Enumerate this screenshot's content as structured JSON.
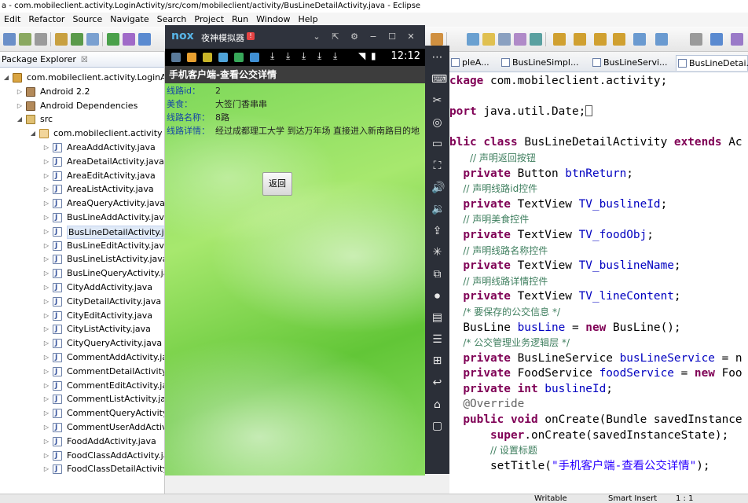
{
  "window": {
    "title": "a - com.mobileclient.activity.LoginActivity/src/com/mobileclient/activity/BusLineDetailActivity.java - Eclipse"
  },
  "menu": [
    "Edit",
    "Refactor",
    "Source",
    "Navigate",
    "Search",
    "Project",
    "Run",
    "Window",
    "Help"
  ],
  "package_explorer": {
    "tab_label": "Package Explorer",
    "tab_close": "☒",
    "nodes": [
      {
        "label": "com.mobileclient.activity.LoginActivity",
        "icon": "project-icon",
        "twisty": "◢"
      },
      {
        "label": "Android 2.2",
        "icon": "library-icon",
        "twisty": "▷"
      },
      {
        "label": "Android Dependencies",
        "icon": "library-icon",
        "twisty": "▷"
      },
      {
        "label": "src",
        "icon": "source-folder-icon",
        "twisty": "◢"
      },
      {
        "label": "com.mobileclient.activity",
        "icon": "package-icon",
        "twisty": "◢"
      },
      {
        "label": "AreaAddActivity.java",
        "icon": "java-file-icon",
        "twisty": "▷"
      },
      {
        "label": "AreaDetailActivity.java",
        "icon": "java-file-icon",
        "twisty": "▷"
      },
      {
        "label": "AreaEditActivity.java",
        "icon": "java-file-icon",
        "twisty": "▷"
      },
      {
        "label": "AreaListActivity.java",
        "icon": "java-file-icon",
        "twisty": "▷"
      },
      {
        "label": "AreaQueryActivity.java",
        "icon": "java-file-icon",
        "twisty": "▷"
      },
      {
        "label": "BusLineAddActivity.java",
        "icon": "java-file-icon",
        "twisty": "▷"
      },
      {
        "label": "BusLineDetailActivity.java",
        "icon": "java-file-icon",
        "twisty": "▷",
        "selected": true
      },
      {
        "label": "BusLineEditActivity.java",
        "icon": "java-file-icon",
        "twisty": "▷"
      },
      {
        "label": "BusLineListActivity.java",
        "icon": "java-file-icon",
        "twisty": "▷"
      },
      {
        "label": "BusLineQueryActivity.java",
        "icon": "java-file-icon",
        "twisty": "▷"
      },
      {
        "label": "CityAddActivity.java",
        "icon": "java-file-icon",
        "twisty": "▷"
      },
      {
        "label": "CityDetailActivity.java",
        "icon": "java-file-icon",
        "twisty": "▷"
      },
      {
        "label": "CityEditActivity.java",
        "icon": "java-file-icon",
        "twisty": "▷"
      },
      {
        "label": "CityListActivity.java",
        "icon": "java-file-icon",
        "twisty": "▷"
      },
      {
        "label": "CityQueryActivity.java",
        "icon": "java-file-icon",
        "twisty": "▷"
      },
      {
        "label": "CommentAddActivity.java",
        "icon": "java-file-icon",
        "twisty": "▷"
      },
      {
        "label": "CommentDetailActivity.java",
        "icon": "java-file-icon",
        "twisty": "▷"
      },
      {
        "label": "CommentEditActivity.java",
        "icon": "java-file-icon",
        "twisty": "▷"
      },
      {
        "label": "CommentListActivity.java",
        "icon": "java-file-icon",
        "twisty": "▷"
      },
      {
        "label": "CommentQueryActivity.java",
        "icon": "java-file-icon",
        "twisty": "▷"
      },
      {
        "label": "CommentUserAddActivity.ja",
        "icon": "java-file-icon",
        "twisty": "▷"
      },
      {
        "label": "FoodAddActivity.java",
        "icon": "java-file-icon",
        "twisty": "▷"
      },
      {
        "label": "FoodClassAddActivity.java",
        "icon": "java-file-icon",
        "twisty": "▷"
      },
      {
        "label": "FoodClassDetailActivity.java",
        "icon": "java-file-icon",
        "twisty": "▷"
      }
    ]
  },
  "editor": {
    "tabs": [
      "pleA...",
      "BusLineSimpl...",
      "BusLineServi...",
      "BusLineDetai..."
    ],
    "active_tab": 3,
    "lines": [
      [
        {
          "t": "ckage ",
          "c": "kw"
        },
        {
          "t": "com.mobileclient.activity;",
          "c": ""
        }
      ],
      [],
      [
        {
          "t": "port ",
          "c": "kw"
        },
        {
          "t": "java.util.Date;",
          "c": ""
        }
      ],
      [],
      [
        {
          "t": "blic ",
          "c": "kw"
        },
        {
          "t": "class ",
          "c": "kw"
        },
        {
          "t": "BusLineDetailActivity ",
          "c": ""
        },
        {
          "t": "extends ",
          "c": "kw"
        },
        {
          "t": "Ac",
          "c": ""
        }
      ],
      [
        {
          "t": "   ",
          "c": ""
        },
        {
          "t": "// 声明返回按钮",
          "c": "cm"
        }
      ],
      [
        {
          "t": "  ",
          "c": ""
        },
        {
          "t": "private ",
          "c": "kw"
        },
        {
          "t": "Button ",
          "c": ""
        },
        {
          "t": "btnReturn",
          "c": "fld"
        },
        {
          "t": ";",
          "c": ""
        }
      ],
      [
        {
          "t": "  ",
          "c": ""
        },
        {
          "t": "// 声明线路id控件",
          "c": "cm"
        }
      ],
      [
        {
          "t": "  ",
          "c": ""
        },
        {
          "t": "private ",
          "c": "kw"
        },
        {
          "t": "TextView ",
          "c": ""
        },
        {
          "t": "TV_buslineId",
          "c": "fld"
        },
        {
          "t": ";",
          "c": ""
        }
      ],
      [
        {
          "t": "  ",
          "c": ""
        },
        {
          "t": "// 声明美食控件",
          "c": "cm"
        }
      ],
      [
        {
          "t": "  ",
          "c": ""
        },
        {
          "t": "private ",
          "c": "kw"
        },
        {
          "t": "TextView ",
          "c": ""
        },
        {
          "t": "TV_foodObj",
          "c": "fld"
        },
        {
          "t": ";",
          "c": ""
        }
      ],
      [
        {
          "t": "  ",
          "c": ""
        },
        {
          "t": "// 声明线路名称控件",
          "c": "cm"
        }
      ],
      [
        {
          "t": "  ",
          "c": ""
        },
        {
          "t": "private ",
          "c": "kw"
        },
        {
          "t": "TextView ",
          "c": ""
        },
        {
          "t": "TV_buslineName",
          "c": "fld"
        },
        {
          "t": ";",
          "c": ""
        }
      ],
      [
        {
          "t": "  ",
          "c": ""
        },
        {
          "t": "// 声明线路详情控件",
          "c": "cm"
        }
      ],
      [
        {
          "t": "  ",
          "c": ""
        },
        {
          "t": "private ",
          "c": "kw"
        },
        {
          "t": "TextView ",
          "c": ""
        },
        {
          "t": "TV_lineContent",
          "c": "fld"
        },
        {
          "t": ";",
          "c": ""
        }
      ],
      [
        {
          "t": "  ",
          "c": ""
        },
        {
          "t": "/* 要保存的公交信息 */",
          "c": "cm"
        }
      ],
      [
        {
          "t": "  ",
          "c": ""
        },
        {
          "t": "BusLine ",
          "c": ""
        },
        {
          "t": "busLine ",
          "c": "fld"
        },
        {
          "t": "= ",
          "c": ""
        },
        {
          "t": "new ",
          "c": "kw"
        },
        {
          "t": "BusLine();",
          "c": ""
        }
      ],
      [
        {
          "t": "  ",
          "c": ""
        },
        {
          "t": "/* 公交管理业务逻辑层 */",
          "c": "cm"
        }
      ],
      [
        {
          "t": "  ",
          "c": ""
        },
        {
          "t": "private ",
          "c": "kw"
        },
        {
          "t": "BusLineService ",
          "c": ""
        },
        {
          "t": "busLineService ",
          "c": "fld"
        },
        {
          "t": "= n",
          "c": ""
        }
      ],
      [
        {
          "t": "  ",
          "c": ""
        },
        {
          "t": "private ",
          "c": "kw"
        },
        {
          "t": "FoodService ",
          "c": ""
        },
        {
          "t": "foodService ",
          "c": "fld"
        },
        {
          "t": "= ",
          "c": ""
        },
        {
          "t": "new ",
          "c": "kw"
        },
        {
          "t": "Foo",
          "c": ""
        }
      ],
      [
        {
          "t": "  ",
          "c": ""
        },
        {
          "t": "private ",
          "c": "kw"
        },
        {
          "t": "int ",
          "c": "kw"
        },
        {
          "t": "buslineId",
          "c": "fld"
        },
        {
          "t": ";",
          "c": ""
        }
      ],
      [
        {
          "t": "  ",
          "c": ""
        },
        {
          "t": "@Override",
          "c": "ann"
        }
      ],
      [
        {
          "t": "  ",
          "c": ""
        },
        {
          "t": "public ",
          "c": "kw"
        },
        {
          "t": "void ",
          "c": "kw"
        },
        {
          "t": "onCreate(Bundle savedInstance",
          "c": ""
        }
      ],
      [
        {
          "t": "      ",
          "c": ""
        },
        {
          "t": "super",
          "c": "kw"
        },
        {
          "t": ".onCreate(savedInstanceState);",
          "c": ""
        }
      ],
      [
        {
          "t": "      ",
          "c": ""
        },
        {
          "t": "// 设置标题",
          "c": "cm"
        }
      ],
      [
        {
          "t": "      ",
          "c": ""
        },
        {
          "t": "setTitle(",
          "c": ""
        },
        {
          "t": "\"手机客户端-查看公交详情\"",
          "c": "str"
        },
        {
          "t": ");",
          "c": ""
        }
      ]
    ]
  },
  "emulator": {
    "logo": "nox",
    "title": "夜神模拟器",
    "badge": "!",
    "clock": "12:12",
    "app_title": "手机客户端-查看公交详情",
    "fields": [
      {
        "label": "线路id：",
        "value": "2"
      },
      {
        "label": "美食：",
        "value": "大签门香串串"
      },
      {
        "label": "线路名称：",
        "value": "8路"
      },
      {
        "label": "线路详情：",
        "value": "经过成都理工大学 到达万年场 直接进入新南路目的地"
      }
    ],
    "back_button": "返回"
  },
  "status": {
    "writable": "Writable",
    "insert_mode": "Smart Insert",
    "position": "1 : 1"
  },
  "colors": {
    "keyword": "#7f0055",
    "field": "#0000c0",
    "comment": "#3f7f5f",
    "string": "#2a00ff",
    "emulator_bg": "#2b2f38",
    "app_bar": "#3d3d3d",
    "field_label": "#1747a6"
  }
}
